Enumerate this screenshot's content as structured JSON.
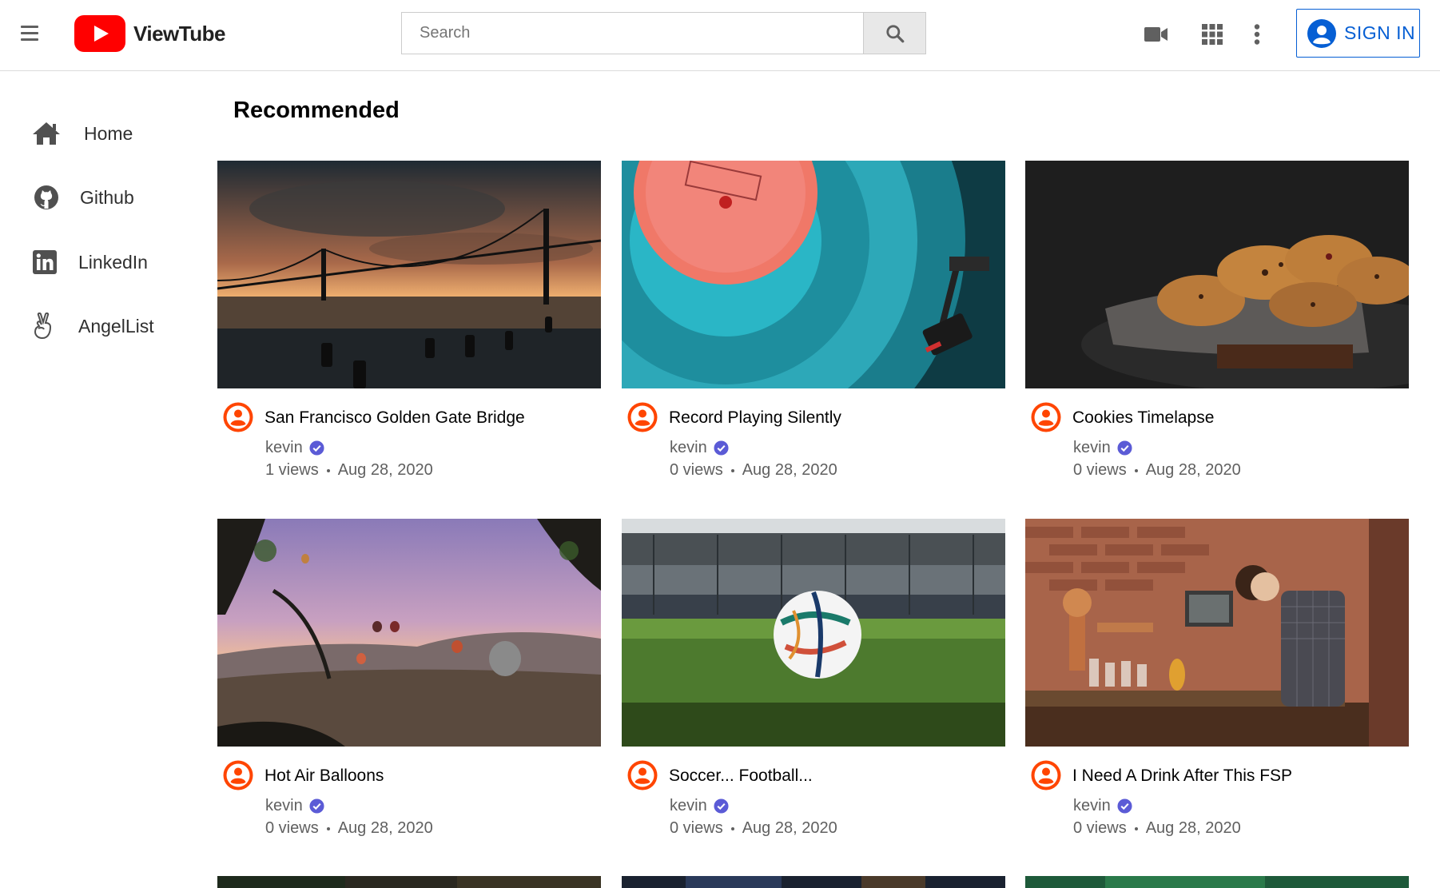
{
  "header": {
    "app_name": "ViewTube",
    "search_placeholder": "Search",
    "signin_label": "SIGN IN",
    "icons": [
      "menu-icon",
      "search-icon",
      "video-camera-icon",
      "apps-grid-icon",
      "more-vert-icon",
      "account-circle-icon"
    ]
  },
  "sidebar": {
    "items": [
      {
        "label": "Home",
        "icon": "home-icon"
      },
      {
        "label": "Github",
        "icon": "github-icon"
      },
      {
        "label": "LinkedIn",
        "icon": "linkedin-icon"
      },
      {
        "label": "AngelList",
        "icon": "angellist-icon"
      }
    ]
  },
  "main": {
    "section_title": "Recommended",
    "videos": [
      {
        "title": "San Francisco Golden Gate Bridge",
        "channel": "kevin",
        "views": "1 views",
        "date": "Aug 28, 2020"
      },
      {
        "title": "Record Playing Silently",
        "channel": "kevin",
        "views": "0 views",
        "date": "Aug 28, 2020"
      },
      {
        "title": "Cookies Timelapse",
        "channel": "kevin",
        "views": "0 views",
        "date": "Aug 28, 2020"
      },
      {
        "title": "Hot Air Balloons",
        "channel": "kevin",
        "views": "0 views",
        "date": "Aug 28, 2020"
      },
      {
        "title": "Soccer... Football...",
        "channel": "kevin",
        "views": "0 views",
        "date": "Aug 28, 2020"
      },
      {
        "title": "I Need A Drink After This FSP",
        "channel": "kevin",
        "views": "0 views",
        "date": "Aug 28, 2020"
      }
    ]
  },
  "colors": {
    "brand_red": "#ff0000",
    "link_blue": "#065fd4",
    "avatar_orange": "#ff4500",
    "verified_purple": "#5b5bd6"
  }
}
